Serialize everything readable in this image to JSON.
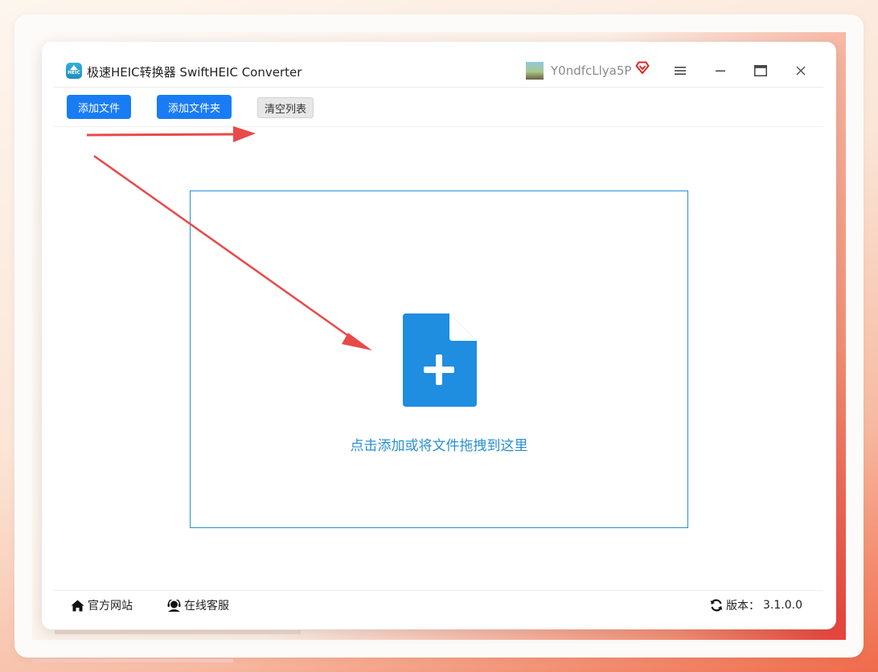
{
  "app": {
    "title": "极速HEIC转换器 SwiftHEIC Converter",
    "logo_text": "HEIC",
    "username": "Y0ndfcLlya5P"
  },
  "toolbar": {
    "add_file_label": "添加文件",
    "add_folder_label": "添加文件夹",
    "clear_list_label": "清空列表"
  },
  "dropzone": {
    "hint": "点击添加或将文件拖拽到这里"
  },
  "footer": {
    "website_label": "官方网站",
    "support_label": "在线客服",
    "version_label": "版本：",
    "version_value": "3.1.0.0"
  },
  "colors": {
    "primary": "#1a7cf5",
    "accent_blue": "#2a8fd1",
    "icon_blue": "#1f8de0",
    "annotation_red": "#e84a4a",
    "vip_red": "#e02424"
  }
}
